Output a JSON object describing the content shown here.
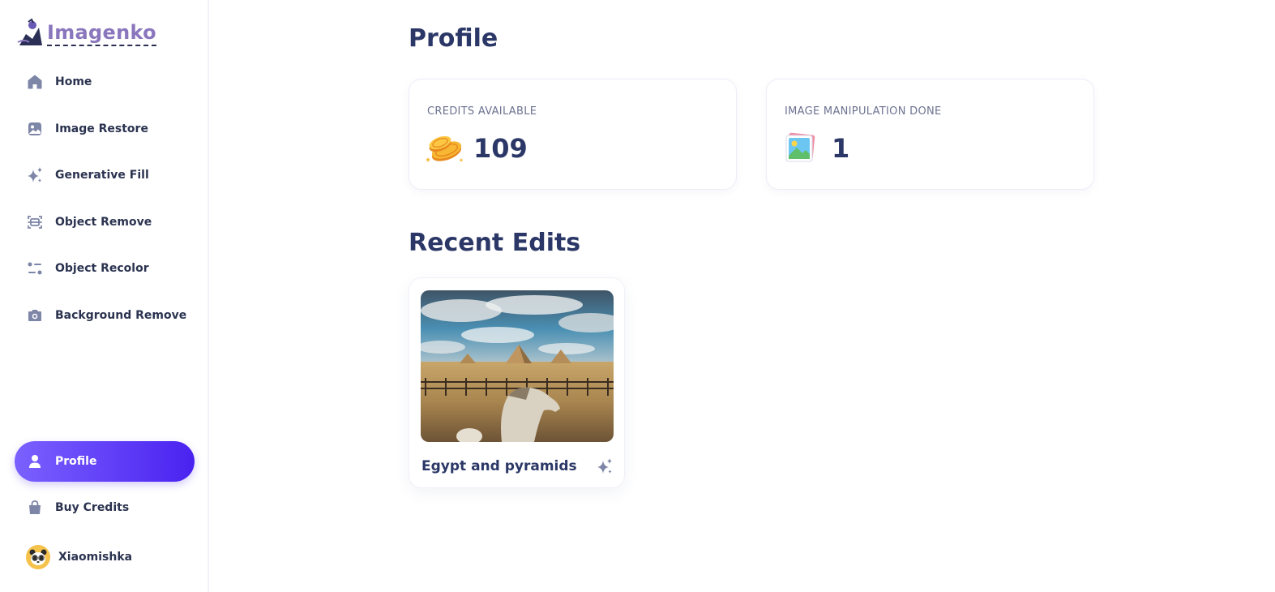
{
  "app": {
    "name": "Imagenko"
  },
  "sidebar": {
    "items": [
      {
        "label": "Home",
        "icon": "home-icon"
      },
      {
        "label": "Image Restore",
        "icon": "image-icon"
      },
      {
        "label": "Generative Fill",
        "icon": "sparkles-icon"
      },
      {
        "label": "Object Remove",
        "icon": "scan-icon"
      },
      {
        "label": "Object Recolor",
        "icon": "filter-icon"
      },
      {
        "label": "Background Remove",
        "icon": "camera-icon"
      }
    ],
    "bottom_items": [
      {
        "label": "Profile",
        "icon": "user-icon",
        "active": true
      },
      {
        "label": "Buy Credits",
        "icon": "bag-icon"
      }
    ],
    "user": {
      "name": "Xiaomishka",
      "avatar": "panda-avatar"
    }
  },
  "main": {
    "title": "Profile",
    "stats": [
      {
        "label": "CREDITS AVAILABLE",
        "value": "109",
        "icon": "coins-icon"
      },
      {
        "label": "IMAGE MANIPULATION DONE",
        "value": "1",
        "icon": "picture-icon"
      }
    ],
    "recent_title": "Recent Edits",
    "recent_edits": [
      {
        "title": "Egypt and pyramids",
        "icon": "sparkles-icon"
      }
    ]
  },
  "colors": {
    "accent_start": "#7b61ff",
    "accent_end": "#4a22f0",
    "heading": "#2b3766",
    "icon": "#7e86a8"
  }
}
